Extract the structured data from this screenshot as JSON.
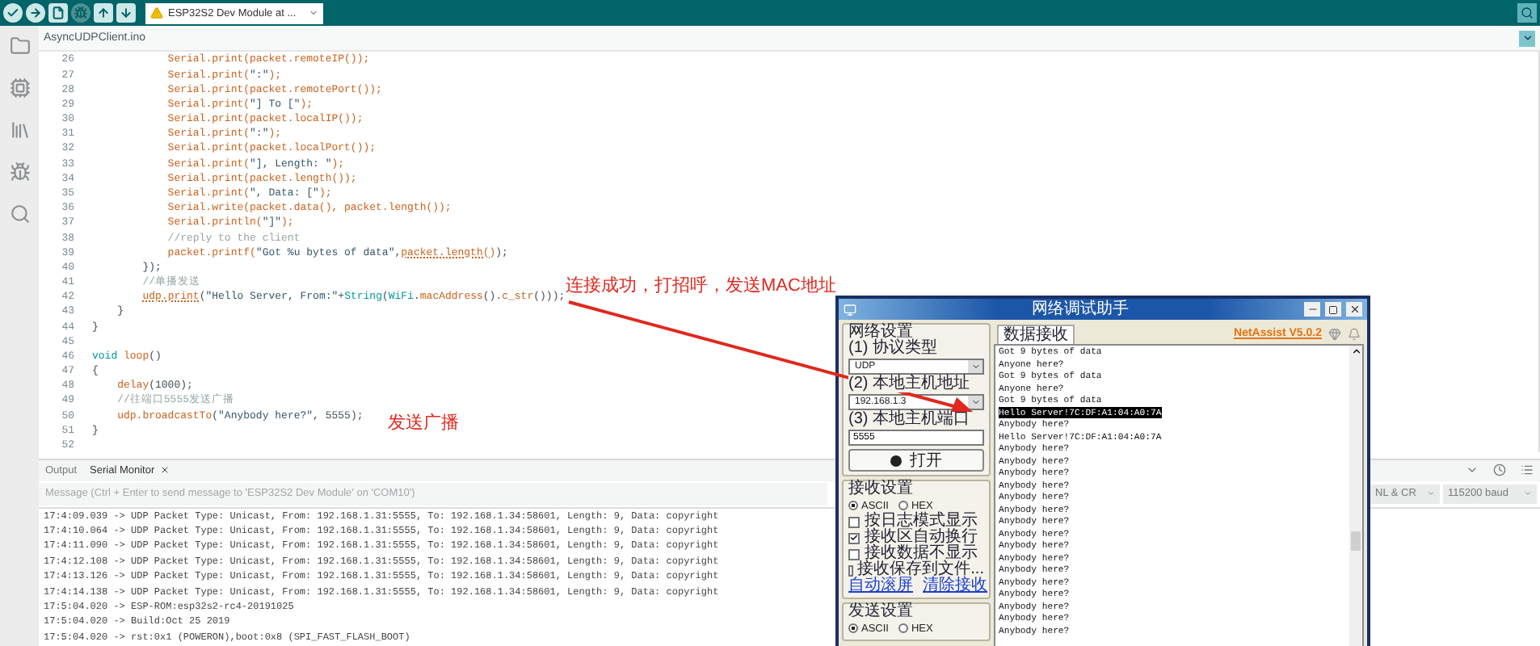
{
  "toolbar": [
    {
      "kind": "verify",
      "disabled": false
    },
    {
      "kind": "upload",
      "disabled": false
    },
    {
      "kind": "new",
      "disabled": false
    },
    {
      "kind": "debug",
      "disabled": true
    },
    {
      "kind": "plotter",
      "disabled": false
    },
    {
      "kind": "monitor",
      "disabled": false
    }
  ],
  "board_selector": {
    "label": "ESP32S2 Dev Module at ..."
  },
  "file_tabs": [
    {
      "label": "AsyncUDPClient.ino",
      "selected": true
    }
  ],
  "editor": {
    "lines": [
      {
        "number": "26",
        "segments": [
          {
            "text": "            Serial.print(packet.remoteIP());",
            "kind": "f"
          }
        ]
      },
      {
        "number": "27",
        "segments": [
          {
            "text": "            Serial.print(",
            "kind": "f"
          },
          {
            "text": "\":\"",
            "kind": "s"
          },
          {
            "text": ");",
            "kind": "f"
          }
        ]
      },
      {
        "number": "28",
        "segments": [
          {
            "text": "            Serial.print(packet.remotePort());",
            "kind": "f"
          }
        ]
      },
      {
        "number": "29",
        "segments": [
          {
            "text": "            Serial.print(",
            "kind": "f"
          },
          {
            "text": "\"] To [\"",
            "kind": "s"
          },
          {
            "text": ");",
            "kind": "f"
          }
        ]
      },
      {
        "number": "30",
        "segments": [
          {
            "text": "            Serial.print(packet.localIP());",
            "kind": "f"
          }
        ]
      },
      {
        "number": "31",
        "segments": [
          {
            "text": "            Serial.print(",
            "kind": "f"
          },
          {
            "text": "\":\"",
            "kind": "s"
          },
          {
            "text": ");",
            "kind": "f"
          }
        ]
      },
      {
        "number": "32",
        "segments": [
          {
            "text": "            Serial.print(packet.localPort());",
            "kind": "f"
          }
        ]
      },
      {
        "number": "33",
        "segments": [
          {
            "text": "            Serial.print(",
            "kind": "f"
          },
          {
            "text": "\"], Length: \"",
            "kind": "s"
          },
          {
            "text": ");",
            "kind": "f"
          }
        ]
      },
      {
        "number": "34",
        "segments": [
          {
            "text": "            Serial.print(packet.length());",
            "kind": "f"
          }
        ]
      },
      {
        "number": "35",
        "segments": [
          {
            "text": "            Serial.print(",
            "kind": "f"
          },
          {
            "text": "\", Data: [\"",
            "kind": "s"
          },
          {
            "text": ");",
            "kind": "f"
          }
        ]
      },
      {
        "number": "36",
        "segments": [
          {
            "text": "            Serial.write(packet.data(), packet.length());",
            "kind": "f"
          }
        ]
      },
      {
        "number": "37",
        "segments": [
          {
            "text": "            Serial.println(",
            "kind": "f"
          },
          {
            "text": "\"]\"",
            "kind": "s"
          },
          {
            "text": ");",
            "kind": "f"
          }
        ]
      },
      {
        "number": "38",
        "segments": [
          {
            "text": "            //reply to the client",
            "kind": "c"
          }
        ]
      },
      {
        "number": "39",
        "segments": [
          {
            "text": "            packet.printf(",
            "kind": "f"
          },
          {
            "text": "\"Got %u bytes of data\",",
            "kind": "s"
          },
          {
            "text": "packet.length()",
            "kind": "w"
          },
          {
            "text": ");",
            "kind": "p"
          }
        ]
      },
      {
        "number": "40",
        "segments": [
          {
            "text": "        });",
            "kind": "p"
          }
        ]
      },
      {
        "number": "41",
        "segments": [
          {
            "text": "        //单播发送",
            "kind": "c"
          }
        ]
      },
      {
        "number": "42",
        "segments": [
          {
            "text": "        udp.print",
            "kind": "w"
          },
          {
            "text": "(",
            "kind": "p"
          },
          {
            "text": "\"Hello Server, From:\"",
            "kind": "s"
          },
          {
            "text": "+",
            "kind": "p"
          },
          {
            "text": "String",
            "kind": "k"
          },
          {
            "text": "(",
            "kind": "p"
          },
          {
            "text": "WiFi",
            "kind": "k"
          },
          {
            "text": ".",
            "kind": "p"
          },
          {
            "text": "macAddress",
            "kind": "f"
          },
          {
            "text": "().",
            "kind": "p"
          },
          {
            "text": "c_str",
            "kind": "f"
          },
          {
            "text": "()));",
            "kind": "p"
          }
        ]
      },
      {
        "number": "43",
        "segments": [
          {
            "text": "    }",
            "kind": "p"
          }
        ]
      },
      {
        "number": "44",
        "segments": [
          {
            "text": "}",
            "kind": "p"
          }
        ]
      },
      {
        "number": "45"
      },
      {
        "number": "46",
        "segments": [
          {
            "text": "void",
            "kind": "k"
          },
          {
            "text": " loop",
            "kind": "f"
          },
          {
            "text": "()",
            "kind": "p"
          }
        ]
      },
      {
        "number": "47",
        "segments": [
          {
            "text": "{",
            "kind": "p"
          }
        ]
      },
      {
        "number": "48",
        "segments": [
          {
            "text": "    delay",
            "kind": "f"
          },
          {
            "text": "(1000);",
            "kind": "p"
          }
        ]
      },
      {
        "number": "49",
        "segments": [
          {
            "text": "    //往端口5555发送广播",
            "kind": "c"
          }
        ]
      },
      {
        "number": "50",
        "segments": [
          {
            "text": "    udp.broadcastTo",
            "kind": "f"
          },
          {
            "text": "(",
            "kind": "p"
          },
          {
            "text": "\"Anybody here?\"",
            "kind": "s"
          },
          {
            "text": ", 5555);",
            "kind": "p"
          }
        ]
      },
      {
        "number": "51",
        "segments": [
          {
            "text": "}",
            "kind": "p"
          }
        ]
      },
      {
        "number": "52"
      }
    ]
  },
  "annotations": [
    {
      "text": "连接成功，打招呼，发送MAC地址"
    },
    {
      "text": "发送广播"
    }
  ],
  "bottom_panel": {
    "tabs": [
      {
        "label": "Output",
        "selected": false,
        "closable": false
      },
      {
        "label": "Serial Monitor",
        "selected": true,
        "closable": true
      }
    ],
    "message": {
      "placeholder": "Message (Ctrl + Enter to send message to 'ESP32S2 Dev Module' on 'COM10')"
    },
    "line_ending": "NL & CR",
    "baud": "115200 baud",
    "log": [
      "17:4:09.039 -> UDP Packet Type: Unicast, From: 192.168.1.31:5555, To: 192.168.1.34:58601, Length: 9, Data: copyright",
      "17:4:10.064 -> UDP Packet Type: Unicast, From: 192.168.1.31:5555, To: 192.168.1.34:58601, Length: 9, Data: copyright",
      "17:4:11.090 -> UDP Packet Type: Unicast, From: 192.168.1.31:5555, To: 192.168.1.34:58601, Length: 9, Data: copyright",
      "17:4:12.108 -> UDP Packet Type: Unicast, From: 192.168.1.31:5555, To: 192.168.1.34:58601, Length: 9, Data: copyright",
      "17:4:13.126 -> UDP Packet Type: Unicast, From: 192.168.1.31:5555, To: 192.168.1.34:58601, Length: 9, Data: copyright",
      "17:4:14.138 -> UDP Packet Type: Unicast, From: 192.168.1.31:5555, To: 192.168.1.34:58601, Length: 9, Data: copyright",
      "17:5:04.020 -> ESP-ROM:esp32s2-rc4-20191025",
      "17:5:04.020 -> Build:Oct 25 2019",
      "17:5:04.020 -> rst:0x1 (POWERON),boot:0x8 (SPI_FAST_FLASH_BOOT)"
    ]
  },
  "netassist": {
    "title": "网络调试助手",
    "version": "NetAssist V5.0.2",
    "receive_tab": "数据接收",
    "network_settings": {
      "title": "网络设置",
      "protocol_label": "(1) 协议类型",
      "protocol": "UDP",
      "address_label": "(2) 本地主机地址",
      "address": "192.168.1.3",
      "port_label": "(3) 本地主机端口",
      "port": "5555",
      "open_button": "打开"
    },
    "receive_settings": {
      "title": "接收设置",
      "encodings": [
        {
          "label": "ASCII",
          "selected": true
        },
        {
          "label": "HEX",
          "selected": false
        }
      ],
      "options": [
        {
          "label": "按日志模式显示",
          "checked": false
        },
        {
          "label": "接收区自动换行",
          "checked": true
        },
        {
          "label": "接收数据不显示",
          "checked": false
        },
        {
          "label": "接收保存到文件...",
          "checked": false
        }
      ],
      "links": [
        "自动滚屏",
        "清除接收"
      ]
    },
    "send_settings": {
      "title": "发送设置",
      "encodings": [
        {
          "label": "ASCII",
          "selected": true
        },
        {
          "label": "HEX",
          "selected": false
        }
      ]
    },
    "lines": [
      {
        "text": "Got 9 bytes of data",
        "selected": false
      },
      {
        "text": "Anyone here?",
        "selected": false
      },
      {
        "text": "Got 9 bytes of data",
        "selected": false
      },
      {
        "text": "Anyone here?",
        "selected": false
      },
      {
        "text": "Got 9 bytes of data",
        "selected": false
      },
      {
        "text": "Hello Server!7C:DF:A1:04:A0:7A",
        "selected": true
      },
      {
        "text": "Anybody here?",
        "selected": false
      },
      {
        "text": "Hello Server!7C:DF:A1:04:A0:7A",
        "selected": false
      },
      {
        "text": "Anybody here?",
        "selected": false
      },
      {
        "text": "Anybody here?",
        "selected": false
      },
      {
        "text": "Anybody here?",
        "selected": false
      },
      {
        "text": "Anybody here?",
        "selected": false
      },
      {
        "text": "Anybody here?",
        "selected": false
      },
      {
        "text": "Anybody here?",
        "selected": false
      },
      {
        "text": "Anybody here?",
        "selected": false
      },
      {
        "text": "Anybody here?",
        "selected": false
      },
      {
        "text": "Anybody here?",
        "selected": false
      },
      {
        "text": "Anybody here?",
        "selected": false
      },
      {
        "text": "Anybody here?",
        "selected": false
      },
      {
        "text": "Anybody here?",
        "selected": false
      },
      {
        "text": "Anybody here?",
        "selected": false
      },
      {
        "text": "Anybody here?",
        "selected": false
      },
      {
        "text": "Anybody here?",
        "selected": false
      },
      {
        "text": "Anybody here?",
        "selected": false
      }
    ]
  }
}
